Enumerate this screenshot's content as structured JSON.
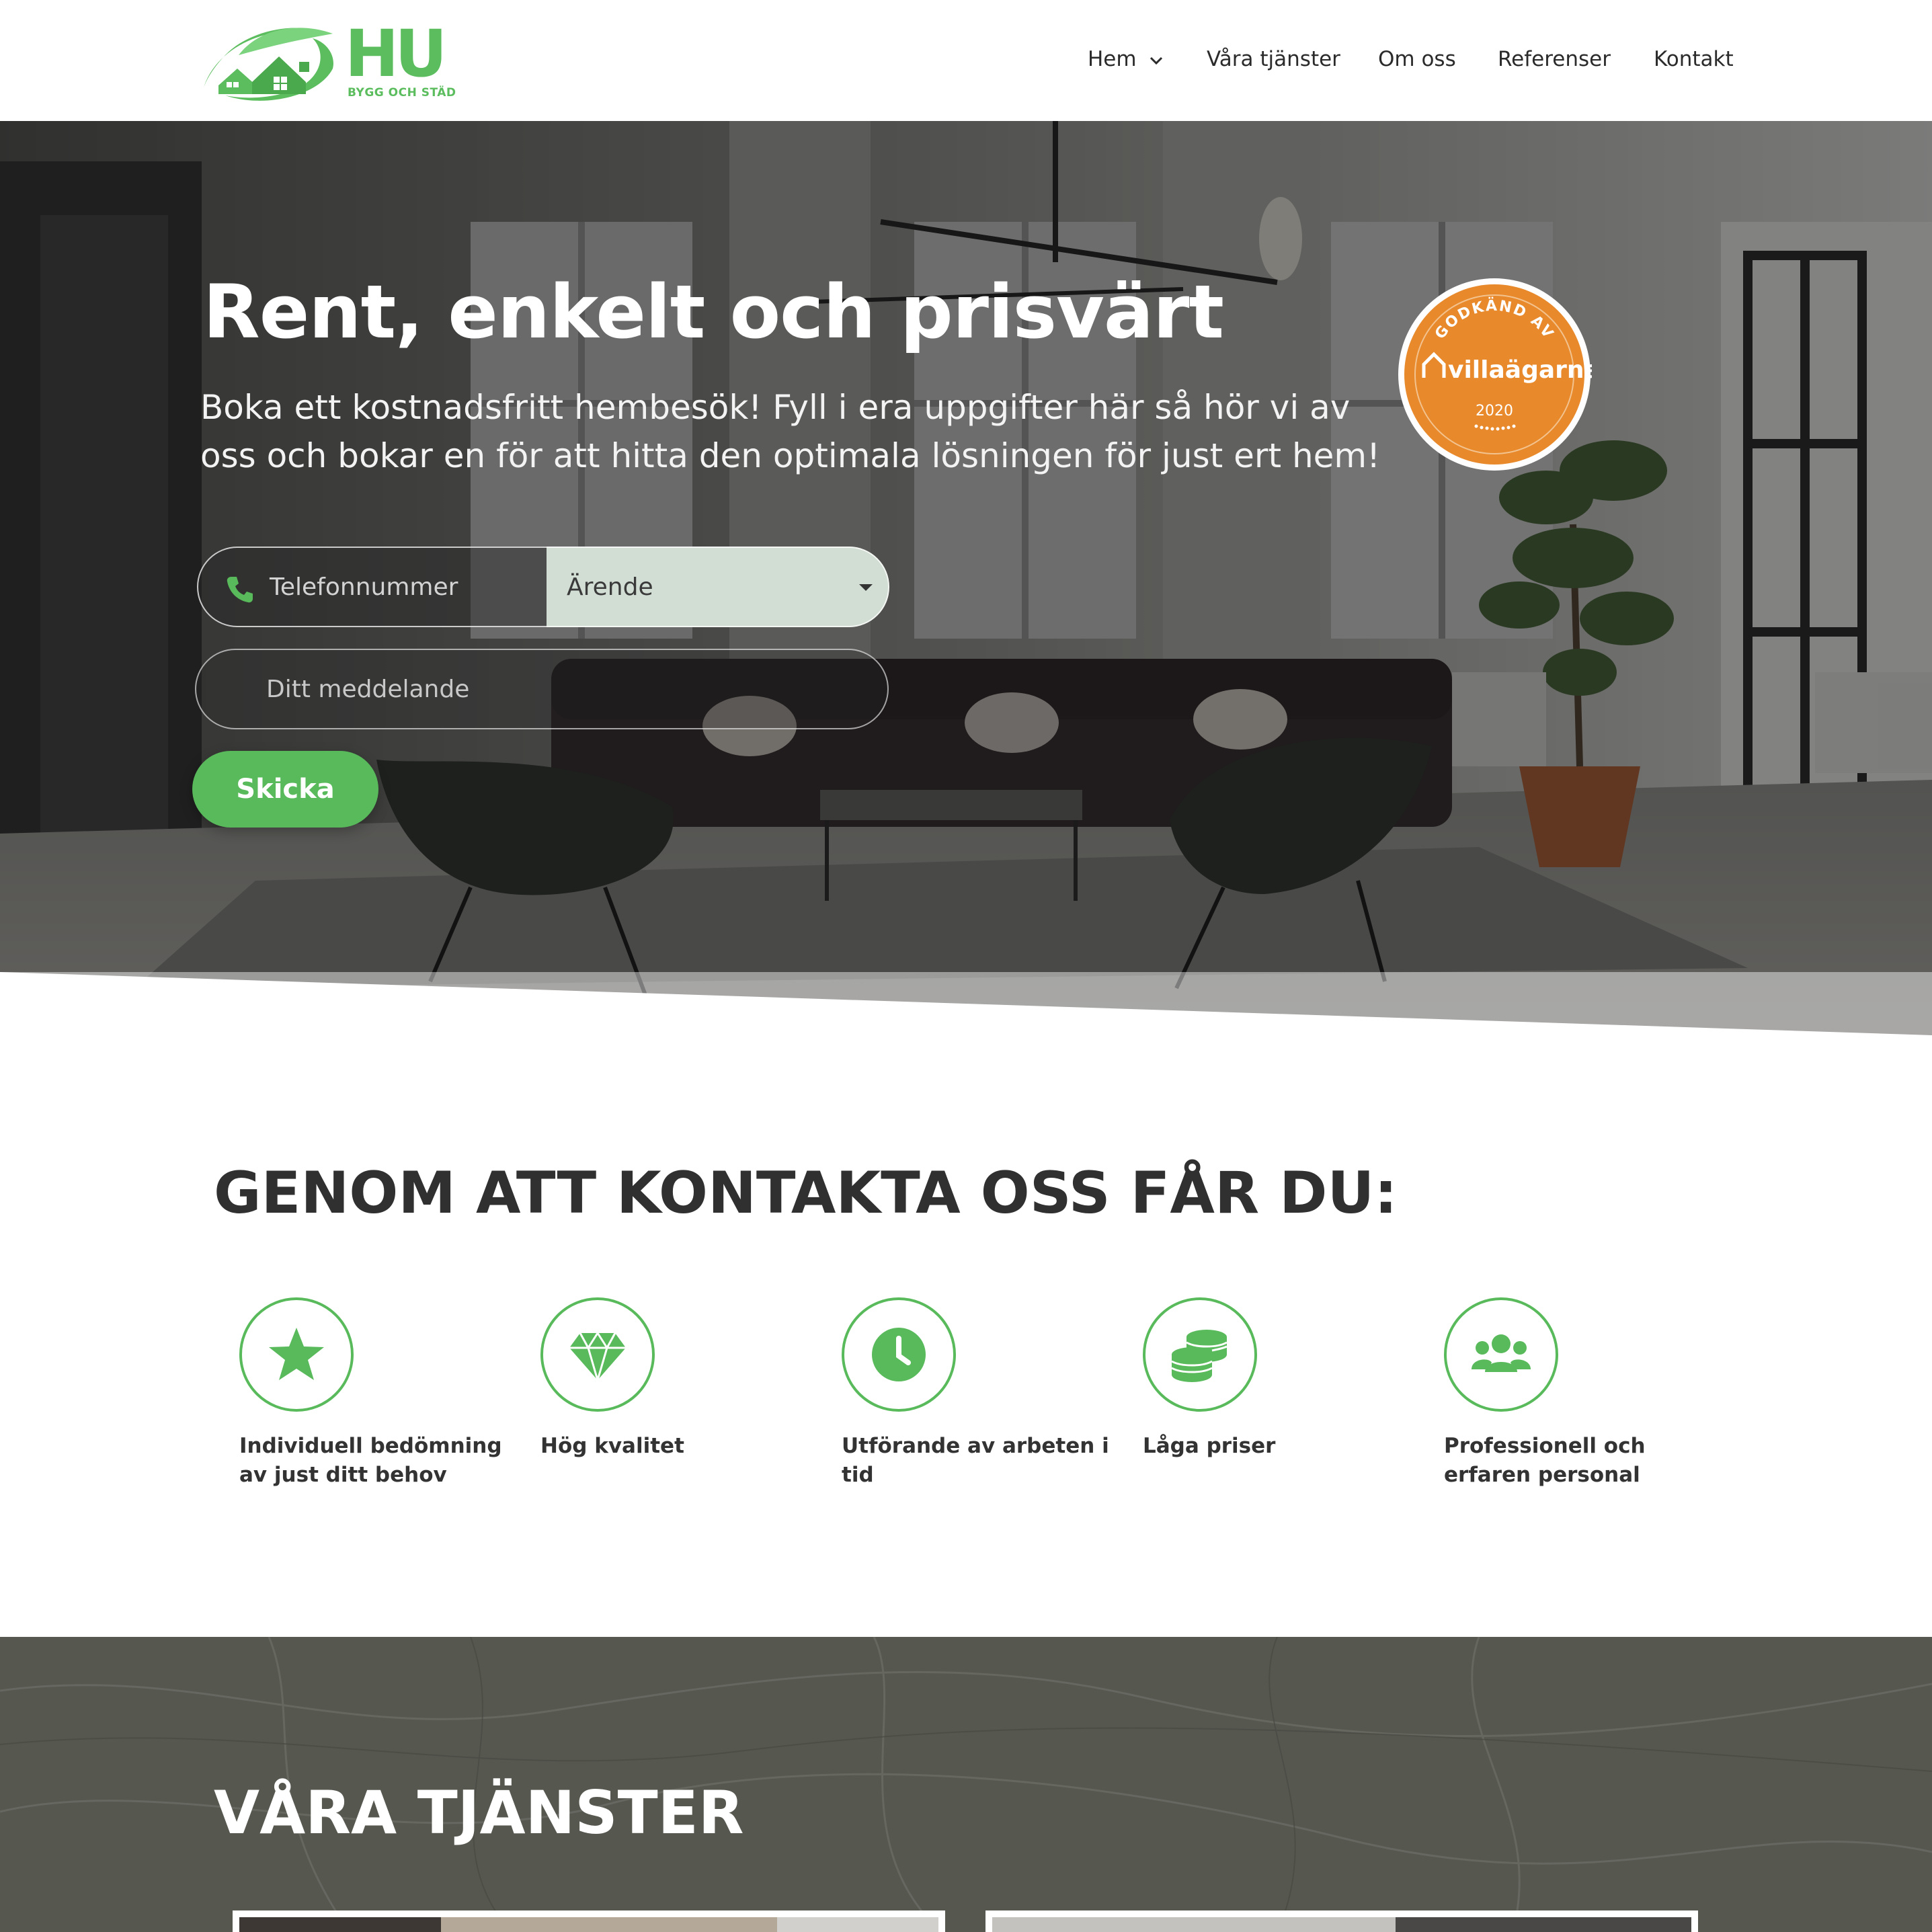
{
  "brand": {
    "logo_text": "HU",
    "logo_tagline": "BYGG OCH STÄD",
    "accent_color": "#58ba5a"
  },
  "nav": {
    "items": [
      {
        "label": "Hem"
      },
      {
        "label": "Våra tjänster"
      },
      {
        "label": "Om oss"
      },
      {
        "label": "Referenser"
      },
      {
        "label": "Kontakt"
      }
    ]
  },
  "hero": {
    "title": "Rent, enkelt och prisvärt",
    "subtitle": "Boka ett kostnadsfritt hembesök! Fyll i era uppgifter här så hör vi av oss och bokar en för att hitta den optimala lösningen för just ert hem!",
    "badge": {
      "top_text": "GODKÄND AV",
      "brand": "villaägarna",
      "year": "2020",
      "color": "#e8892b"
    },
    "form": {
      "phone_placeholder": "Telefonnummer",
      "select_value": "Ärende",
      "message_placeholder": "Ditt meddelande",
      "submit_label": "Skicka"
    }
  },
  "benefits": {
    "title": "GENOM ATT KONTAKTA OSS FÅR DU:",
    "items": [
      {
        "icon": "star-icon",
        "label": "Individuell bedömning av just ditt behov"
      },
      {
        "icon": "diamond-icon",
        "label": "Hög kvalitet"
      },
      {
        "icon": "clock-icon",
        "label": "Utförande av arbeten i tid"
      },
      {
        "icon": "coins-icon",
        "label": "Låga priser"
      },
      {
        "icon": "users-icon",
        "label": "Professionell och erfaren personal"
      }
    ]
  },
  "services": {
    "title": "VÅRA TJÄNSTER"
  }
}
